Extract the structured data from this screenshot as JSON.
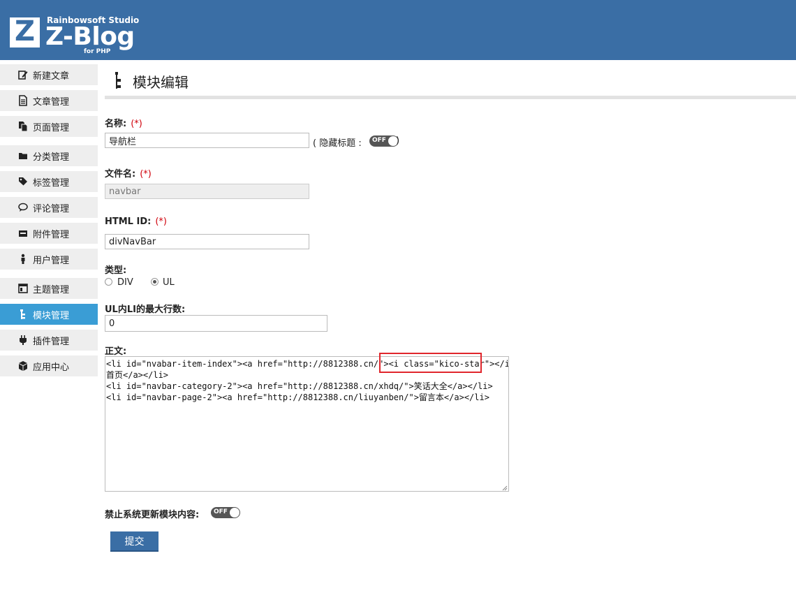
{
  "header": {
    "logo_letter": "Z",
    "studio": "Rainbowsoft Studio",
    "brand": "Z-Blog",
    "sub": "for PHP"
  },
  "sidebar": {
    "items": [
      {
        "label": "新建文章",
        "icon": "edit-icon",
        "active": false
      },
      {
        "label": "文章管理",
        "icon": "document-icon",
        "active": false
      },
      {
        "label": "页面管理",
        "icon": "pages-icon",
        "active": false
      },
      {
        "label": "分类管理",
        "icon": "folder-icon",
        "active": false
      },
      {
        "label": "标签管理",
        "icon": "tag-icon",
        "active": false
      },
      {
        "label": "评论管理",
        "icon": "comment-icon",
        "active": false
      },
      {
        "label": "附件管理",
        "icon": "inbox-icon",
        "active": false
      },
      {
        "label": "用户管理",
        "icon": "user-icon",
        "active": false
      },
      {
        "label": "主题管理",
        "icon": "layout-icon",
        "active": false
      },
      {
        "label": "模块管理",
        "icon": "tree-icon",
        "active": true
      },
      {
        "label": "插件管理",
        "icon": "plug-icon",
        "active": false
      },
      {
        "label": "应用中心",
        "icon": "box-icon",
        "active": false
      }
    ]
  },
  "page": {
    "title": "模块编辑",
    "title_icon": "tree-icon"
  },
  "form": {
    "name_label": "名称:",
    "required_mark": "(*)",
    "name_value": "导航栏",
    "hide_title_label": "( 隐藏标题 :",
    "hide_title_close": ")",
    "hide_title_toggle": "OFF",
    "filename_label": "文件名:",
    "filename_value": "navbar",
    "htmlid_label": "HTML ID:",
    "htmlid_value": "divNavBar",
    "type_label": "类型:",
    "type_options": [
      "DIV",
      "UL"
    ],
    "type_selected": "UL",
    "maxli_label": "UL内LI的最大行数:",
    "maxli_value": "0",
    "content_label": "正文:",
    "content_lines": [
      "<li id=\"nvabar-item-index\"><a href=\"http://8812388.cn/\"><i class=\"kico-star\"></i>",
      "首页</a></li>",
      "<li id=\"navbar-category-2\"><a href=\"http://8812388.cn/xhdq/\">笑话大全</a></li>",
      "<li id=\"navbar-page-2\"><a href=\"http://8812388.cn/liuyanben/\">留言本</a></li>"
    ],
    "no_update_label": "禁止系统更新模块内容:",
    "no_update_toggle": "OFF",
    "submit_label": "提交"
  },
  "colors": {
    "header": "#3a6ea5",
    "active_nav": "#3a9dd5",
    "required": "#d0000a",
    "highlight_box": "#e0262c"
  }
}
